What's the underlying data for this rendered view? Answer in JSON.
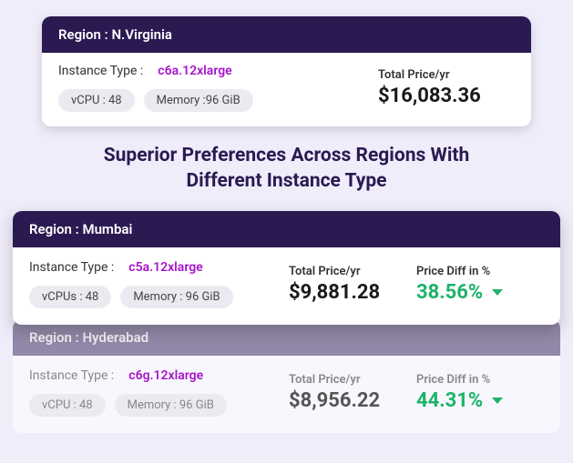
{
  "main_card": {
    "region_label": "Region : N.Virginia",
    "instance_label": "Instance Type :",
    "instance_value": "c6a.12xlarge",
    "chip1": "vCPU : 48",
    "chip2": "Memory :96 GiB",
    "price_label": "Total Price/yr",
    "price_value": "$16,083.36"
  },
  "section_title": "Superior Preferences Across Regions With Different Instance Type",
  "compare": [
    {
      "region_label": "Region : Mumbai",
      "instance_label": "Instance Type :",
      "instance_value": "c5a.12xlarge",
      "chip1": "vCPUs : 48",
      "chip2": "Memory : 96 GiB",
      "price_label": "Total Price/yr",
      "price_value": "$9,881.28",
      "diff_label": "Price Diff in %",
      "diff_value": "38.56%"
    },
    {
      "region_label": "Region : Hyderabad",
      "instance_label": "Instance Type :",
      "instance_value": "c6g.12xlarge",
      "chip1": "vCPU : 48",
      "chip2": "Memory : 96 GiB",
      "price_label": "Total Price/yr",
      "price_value": "$8,956.22",
      "diff_label": "Price Diff in %",
      "diff_value": "44.31%"
    }
  ]
}
